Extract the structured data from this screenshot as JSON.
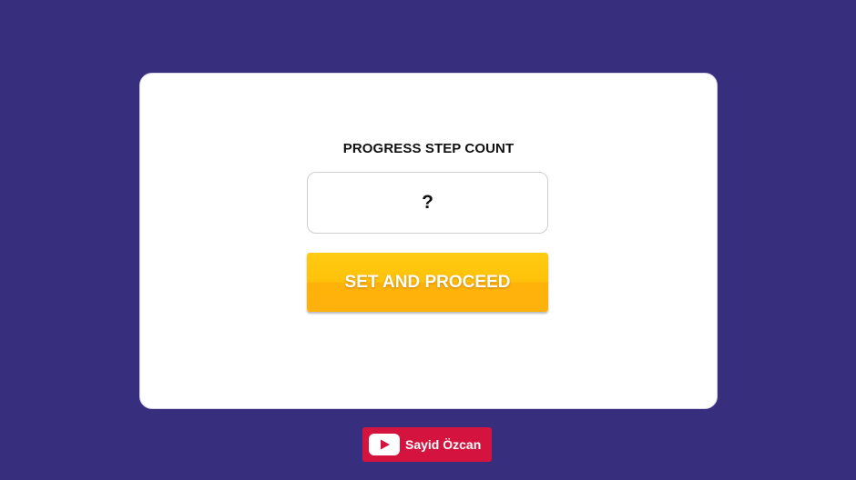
{
  "dialog": {
    "label": "PROGRESS STEP COUNT",
    "input_placeholder": "?",
    "input_value": "",
    "button_label": "SET AND PROCEED"
  },
  "footer": {
    "channel_name": "Sayid Özcan",
    "icon": "youtube-play-icon",
    "badge_color": "#d4143e"
  },
  "colors": {
    "background": "#372e7e",
    "card": "#ffffff",
    "button": "#ffc20a"
  }
}
